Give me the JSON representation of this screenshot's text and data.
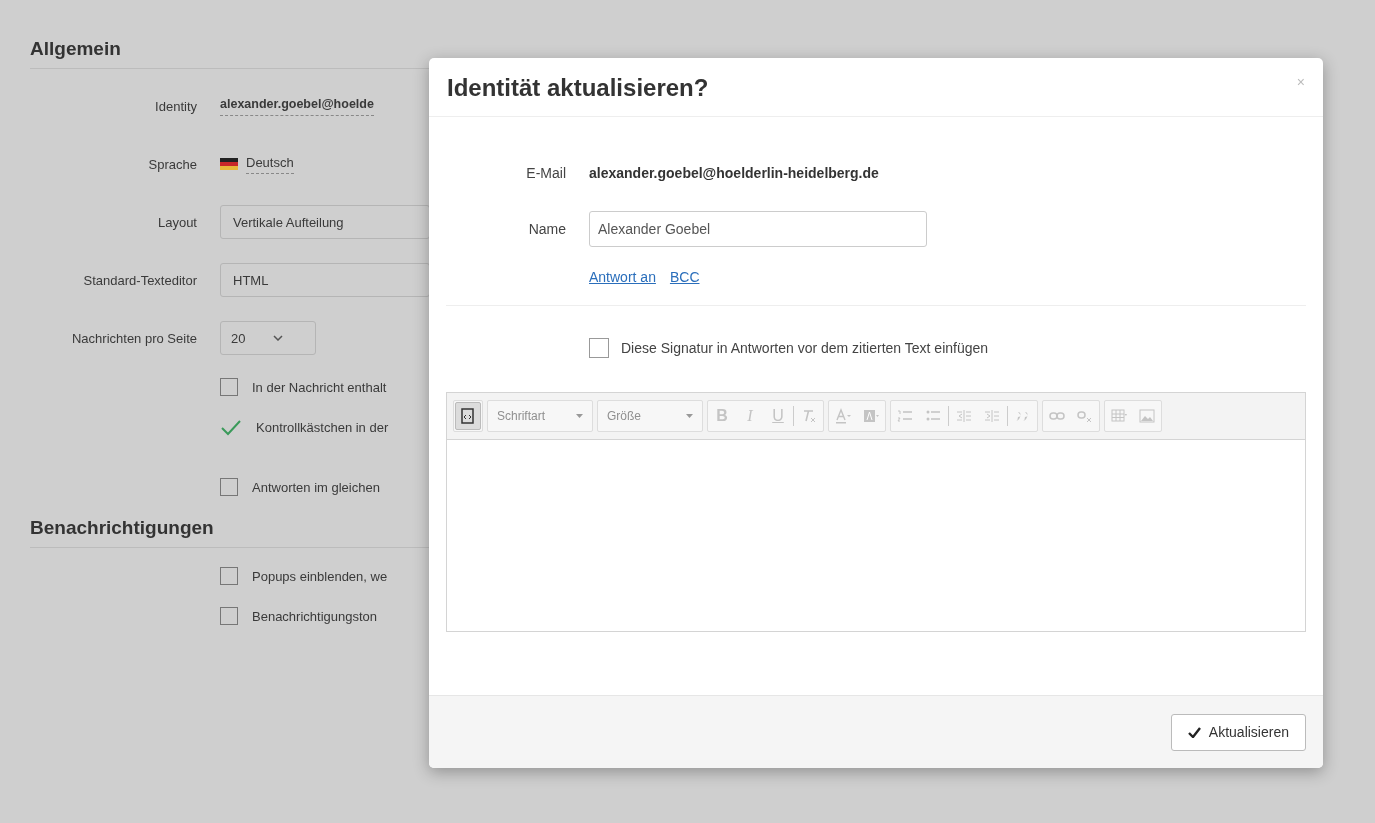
{
  "settings": {
    "sections": [
      {
        "title": "Allgemein",
        "rows": [
          {
            "kind": "identity",
            "label": "Identity",
            "value": "alexander.goebel@hoelde"
          },
          {
            "kind": "language",
            "label": "Sprache",
            "value": "Deutsch"
          },
          {
            "kind": "select",
            "label": "Layout",
            "value": "Vertikale Aufteilung"
          },
          {
            "kind": "select",
            "label": "Standard-Texteditor",
            "value": "HTML"
          },
          {
            "kind": "dropdown",
            "label": "Nachrichten pro Seite",
            "value": "20"
          },
          {
            "kind": "checkbox",
            "label": "In der Nachricht enthalt",
            "checked": false
          },
          {
            "kind": "checkbox",
            "label": "Kontrollkästchen in der",
            "checked": true
          },
          {
            "kind": "spacer"
          },
          {
            "kind": "checkbox",
            "label": "Antworten im gleichen",
            "checked": false
          }
        ]
      },
      {
        "title": "Benachrichtigungen",
        "rows": [
          {
            "kind": "checkbox",
            "label": "Popups einblenden, we",
            "checked": false
          },
          {
            "kind": "checkbox",
            "label": "Benachrichtigungston",
            "checked": false
          }
        ]
      }
    ]
  },
  "dialog": {
    "title": "Identität aktualisieren?",
    "close": "×",
    "email_label": "E-Mail",
    "email": "alexander.goebel@hoelderlin-heidelberg.de",
    "name_label": "Name",
    "name": "Alexander Goebel",
    "links": [
      "Antwort an",
      "BCC"
    ],
    "signature_option": {
      "label": "Diese Signatur in Antworten vor dem zitierten Text einfügen",
      "checked": false
    },
    "toolbar": [
      [
        {
          "kind": "source",
          "disabled": false,
          "selected": true
        }
      ],
      [
        {
          "kind": "combo",
          "label": "Schriftart",
          "disabled": true
        }
      ],
      [
        {
          "kind": "combo",
          "label": "Größe",
          "disabled": true
        }
      ],
      [
        {
          "kind": "bold",
          "label": "B",
          "disabled": true
        },
        {
          "kind": "italic",
          "label": "I",
          "disabled": true
        },
        {
          "kind": "underline",
          "label": "U",
          "disabled": true
        },
        {
          "kind": "sep"
        },
        {
          "kind": "removeformat",
          "disabled": true
        }
      ],
      [
        {
          "kind": "textcolor",
          "disabled": true
        },
        {
          "kind": "bgcolor",
          "disabled": true
        }
      ],
      [
        {
          "kind": "ol",
          "disabled": true
        },
        {
          "kind": "ul",
          "disabled": true
        },
        {
          "kind": "sep"
        },
        {
          "kind": "outdent",
          "disabled": true
        },
        {
          "kind": "indent",
          "disabled": true
        },
        {
          "kind": "sep"
        },
        {
          "kind": "quote",
          "disabled": true
        }
      ],
      [
        {
          "kind": "link",
          "disabled": true
        },
        {
          "kind": "unlink",
          "disabled": true
        }
      ],
      [
        {
          "kind": "table",
          "disabled": true
        },
        {
          "kind": "image",
          "disabled": true
        }
      ]
    ],
    "submit": "Aktualisieren"
  }
}
